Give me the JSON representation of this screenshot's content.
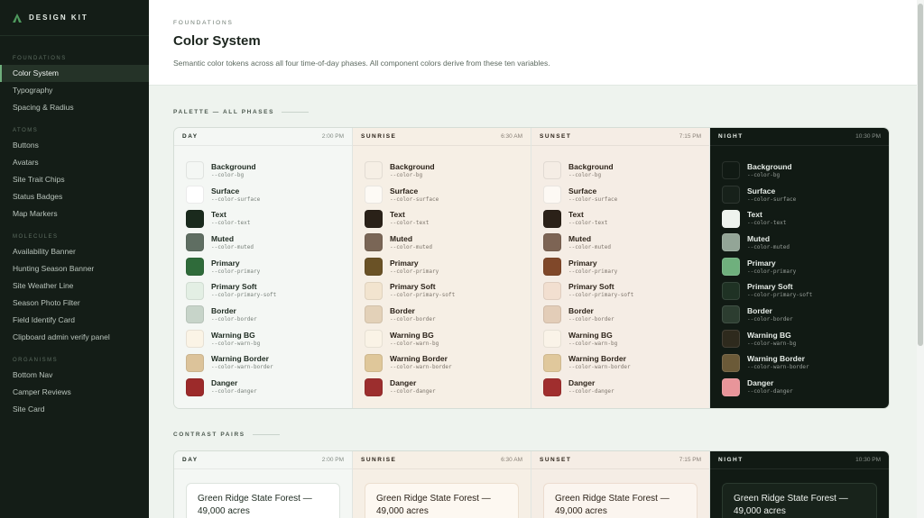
{
  "brand": {
    "name": "DESIGN KIT",
    "color": "#4f9a5e"
  },
  "nav": {
    "sections": [
      {
        "title": "FOUNDATIONS",
        "items": [
          {
            "label": "Color System",
            "active": true
          },
          {
            "label": "Typography"
          },
          {
            "label": "Spacing & Radius"
          }
        ]
      },
      {
        "title": "ATOMS",
        "items": [
          {
            "label": "Buttons"
          },
          {
            "label": "Avatars"
          },
          {
            "label": "Site Trait Chips"
          },
          {
            "label": "Status Badges"
          },
          {
            "label": "Map Markers"
          }
        ]
      },
      {
        "title": "MOLECULES",
        "items": [
          {
            "label": "Availability Banner"
          },
          {
            "label": "Hunting Season Banner"
          },
          {
            "label": "Site Weather Line"
          },
          {
            "label": "Season Photo Filter"
          },
          {
            "label": "Field Identify Card"
          },
          {
            "label": "Clipboard admin verify panel"
          }
        ]
      },
      {
        "title": "ORGANISMS",
        "items": [
          {
            "label": "Bottom Nav"
          },
          {
            "label": "Camper Reviews"
          },
          {
            "label": "Site Card"
          }
        ]
      }
    ]
  },
  "header": {
    "eyebrow": "FOUNDATIONS",
    "title": "Color System",
    "subtitle": "Semantic color tokens across all four time-of-day phases. All component colors derive from these ten variables."
  },
  "palette_section": {
    "label": "PALETTE — ALL PHASES"
  },
  "contrast_section": {
    "label": "CONTRAST PAIRS"
  },
  "token_defs": [
    {
      "name": "Background",
      "var": "--color-bg"
    },
    {
      "name": "Surface",
      "var": "--color-surface"
    },
    {
      "name": "Text",
      "var": "--color-text"
    },
    {
      "name": "Muted",
      "var": "--color-muted"
    },
    {
      "name": "Primary",
      "var": "--color-primary"
    },
    {
      "name": "Primary Soft",
      "var": "--color-primary-soft"
    },
    {
      "name": "Border",
      "var": "--color-border"
    },
    {
      "name": "Warning BG",
      "var": "--color-warn-bg"
    },
    {
      "name": "Warning Border",
      "var": "--color-warn-border"
    },
    {
      "name": "Danger",
      "var": "--color-danger"
    }
  ],
  "phases": [
    {
      "key": "day",
      "name": "DAY",
      "time": "2:00 PM",
      "colors": [
        "#f4f7f4",
        "#ffffff",
        "#1a2a1d",
        "#5f6e62",
        "#2f6b3a",
        "#e3efe4",
        "#c7d4c9",
        "#fbf4e6",
        "#dcc39a",
        "#9c2a2a"
      ]
    },
    {
      "key": "sunrise",
      "name": "SUNRISE",
      "time": "6:30 AM",
      "colors": [
        "#f6efe5",
        "#fdfaf5",
        "#2a2118",
        "#7a6656",
        "#6a5226",
        "#f2e4cf",
        "#e3d1b8",
        "#faf3e6",
        "#dfc79a",
        "#9c2e2e"
      ]
    },
    {
      "key": "sunset",
      "name": "SUNSET",
      "time": "7:15 PM",
      "colors": [
        "#f5ede5",
        "#fdf9f4",
        "#2b2118",
        "#7d6454",
        "#80482a",
        "#f2dfd0",
        "#e3cdb8",
        "#faf3e8",
        "#e0c89c",
        "#a02e2e"
      ]
    },
    {
      "key": "night",
      "name": "NIGHT",
      "time": "10:30 PM",
      "colors": [
        "#111a14",
        "#17211a",
        "#eef3ee",
        "#93a597",
        "#6fb07d",
        "#1f3224",
        "#2c3d30",
        "#2e2a1d",
        "#6b5a38",
        "#e8959a"
      ]
    }
  ],
  "contrast_card": {
    "text": "Green Ridge State Forest — 49,000 acres"
  }
}
